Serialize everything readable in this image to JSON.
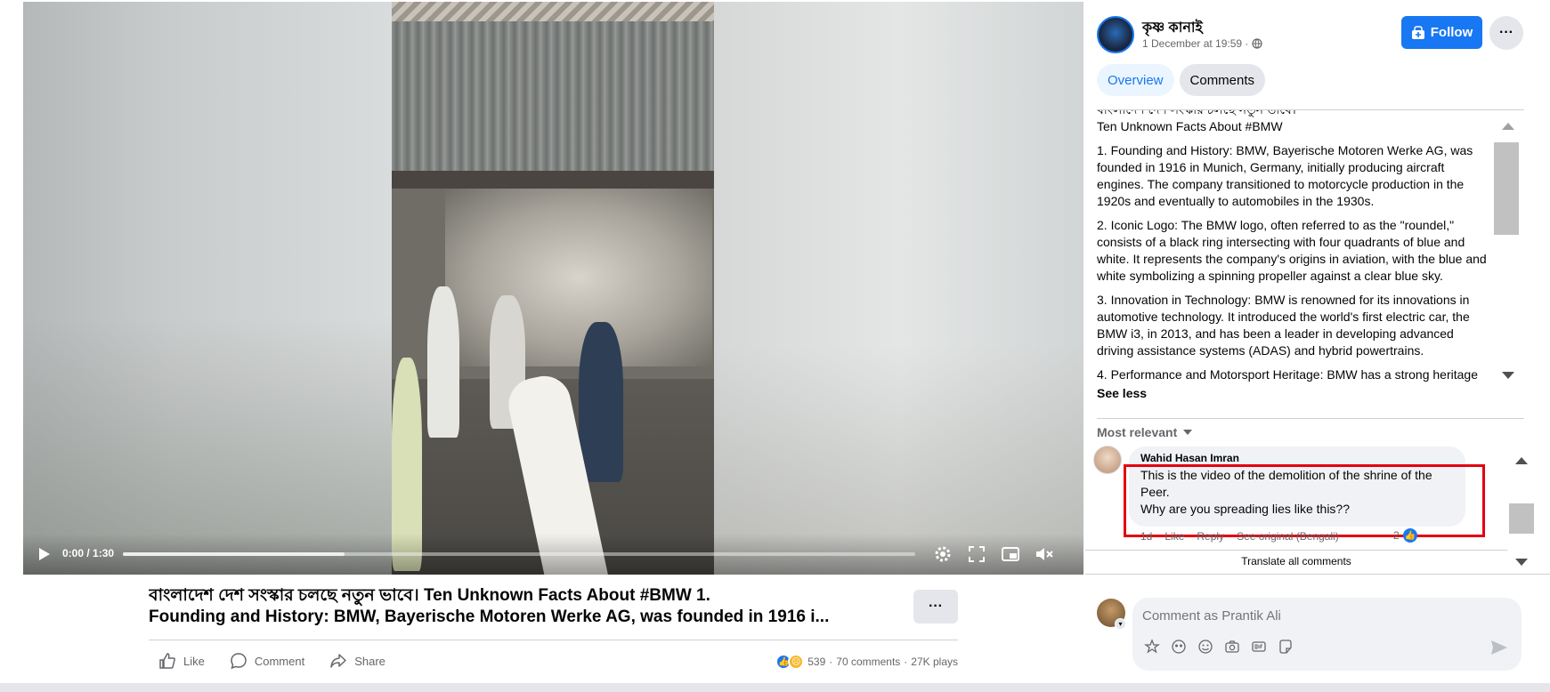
{
  "video": {
    "time": "0:00 / 1:30",
    "buffered_fraction": 0.28
  },
  "post": {
    "title_line1": "বাংলাদেশ দেশ সংস্কার চলছে নতুন ভাবে। Ten Unknown Facts About #BMW 1.",
    "title_line2": "Founding and History: BMW, Bayerische Motoren Werke AG, was founded in 1916 i...",
    "more_label": "···",
    "actions": {
      "like": "Like",
      "comment": "Comment",
      "share": "Share"
    },
    "stats": {
      "reactions": "539",
      "comments": "70 comments",
      "sep": "·",
      "plays": "27K plays"
    }
  },
  "panel": {
    "page_name": "কৃষ্ণ কানাই",
    "date": "1 December at 19:59 ·",
    "follow_label": "Follow",
    "more_label": "···",
    "tabs": [
      "Overview",
      "Comments"
    ],
    "description": {
      "header_bn": "বাংলাদেশ দেশ সংস্কার চলছে নতুন ভাবে।",
      "header_en": "Ten Unknown Facts About #BMW",
      "p1": "1. Founding and History: BMW, Bayerische Motoren Werke AG, was founded in 1916 in Munich, Germany, initially producing aircraft engines. The company transitioned to motorcycle production in the 1920s and eventually to automobiles in the 1930s.",
      "p2": "2. Iconic Logo: The BMW logo, often referred to as the \"roundel,\" consists of a black ring intersecting with four quadrants of blue and white. It represents the company's origins in aviation, with the blue and white symbolizing a spinning propeller against a clear blue sky.",
      "p3": "3. Innovation in Technology: BMW is renowned for its innovations in automotive technology. It introduced the world's first electric car, the BMW i3, in 2013, and has been a leader in developing advanced driving assistance systems (ADAS) and hybrid powertrains.",
      "p4": "4. Performance and Motorsport Heritage: BMW has a strong heritage",
      "see_less": "See less"
    },
    "sort_label": "Most relevant",
    "comment": {
      "author": "Wahid Hasan Imran",
      "line1": "This is the video of the demolition of the shrine of the Peer.",
      "line2": "Why are you spreading lies like this??",
      "time": "1d",
      "like": "Like",
      "reply": "Reply",
      "see_original": "See original (Bengali)",
      "likes": "2"
    },
    "translate_all": "Translate all comments",
    "compose": {
      "placeholder": "Comment as Prantik Ali"
    }
  },
  "colors": {
    "accent": "#1877f2",
    "highlight": "#e3000f",
    "muted_text": "#65676b"
  }
}
